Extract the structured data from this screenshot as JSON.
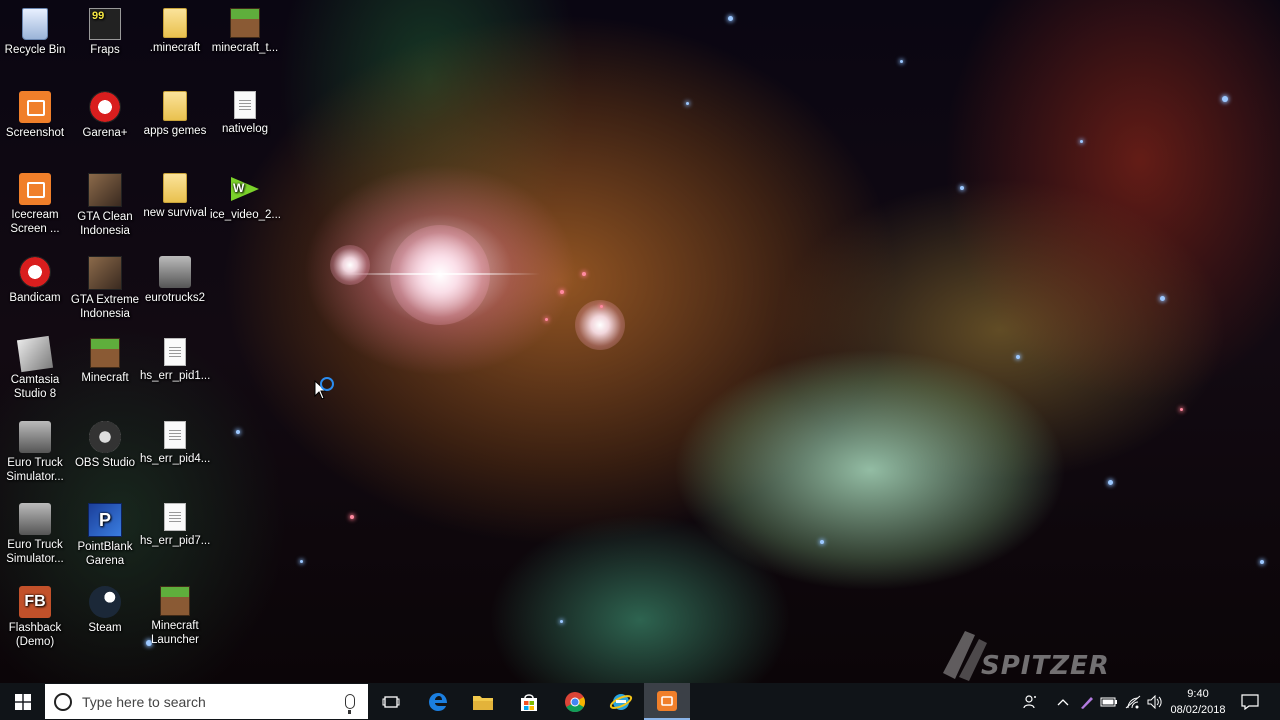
{
  "desktop": {
    "icons": [
      {
        "label": "Recycle Bin",
        "icon": "recycle-bin-icon"
      },
      {
        "label": "Fraps",
        "icon": "fraps-icon",
        "badge": "99"
      },
      {
        "label": ".minecraft",
        "icon": "folder-icon"
      },
      {
        "label": "minecraft_t...",
        "icon": "minecraft-grass-icon"
      },
      {
        "label": "Screenshot",
        "icon": "screenshot-app-icon"
      },
      {
        "label": "Garena+",
        "icon": "garena-icon"
      },
      {
        "label": "apps gemes",
        "icon": "folder-icon"
      },
      {
        "label": "nativelog",
        "icon": "text-document-icon"
      },
      {
        "label": "Icecream Screen ...",
        "icon": "icecream-screen-recorder-icon"
      },
      {
        "label": "GTA Clean Indonesia",
        "icon": "gta-icon"
      },
      {
        "label": "new survival",
        "icon": "folder-icon"
      },
      {
        "label": "ice_video_2...",
        "icon": "video-file-icon"
      },
      {
        "label": "Bandicam",
        "icon": "bandicam-icon"
      },
      {
        "label": "GTA Extreme Indonesia",
        "icon": "gta-icon"
      },
      {
        "label": "eurotrucks2",
        "icon": "truck-icon"
      },
      {
        "label": "Camtasia Studio 8",
        "icon": "camtasia-icon"
      },
      {
        "label": "Minecraft",
        "icon": "minecraft-grass-icon"
      },
      {
        "label": "hs_err_pid1...",
        "icon": "text-document-icon"
      },
      {
        "label": "Euro Truck Simulator...",
        "icon": "truck-icon"
      },
      {
        "label": "OBS Studio",
        "icon": "obs-icon"
      },
      {
        "label": "hs_err_pid4...",
        "icon": "text-document-icon"
      },
      {
        "label": "Euro Truck Simulator...",
        "icon": "truck-icon"
      },
      {
        "label": "PointBlank Garena",
        "icon": "pointblank-icon"
      },
      {
        "label": "hs_err_pid7...",
        "icon": "text-document-icon"
      },
      {
        "label": "Flashback (Demo)",
        "icon": "flashback-icon",
        "glyph": "FB"
      },
      {
        "label": "Steam",
        "icon": "steam-icon"
      },
      {
        "label": "Minecraft Launcher",
        "icon": "minecraft-grass-icon"
      }
    ],
    "watermark": "SPITZER"
  },
  "taskbar": {
    "search_placeholder": "Type here to search",
    "pinned": [
      {
        "name": "task-view-icon"
      },
      {
        "name": "edge-icon"
      },
      {
        "name": "file-explorer-icon"
      },
      {
        "name": "store-icon"
      },
      {
        "name": "chrome-icon"
      },
      {
        "name": "ie-icon"
      },
      {
        "name": "screenshot-app-icon",
        "active": true
      }
    ],
    "clock": {
      "time": "9:40",
      "date": "08/02/2018"
    }
  },
  "colors": {
    "taskbar_bg": "#101418",
    "active_app_bg": "#3b4047",
    "accent": "#2a8cf0"
  }
}
